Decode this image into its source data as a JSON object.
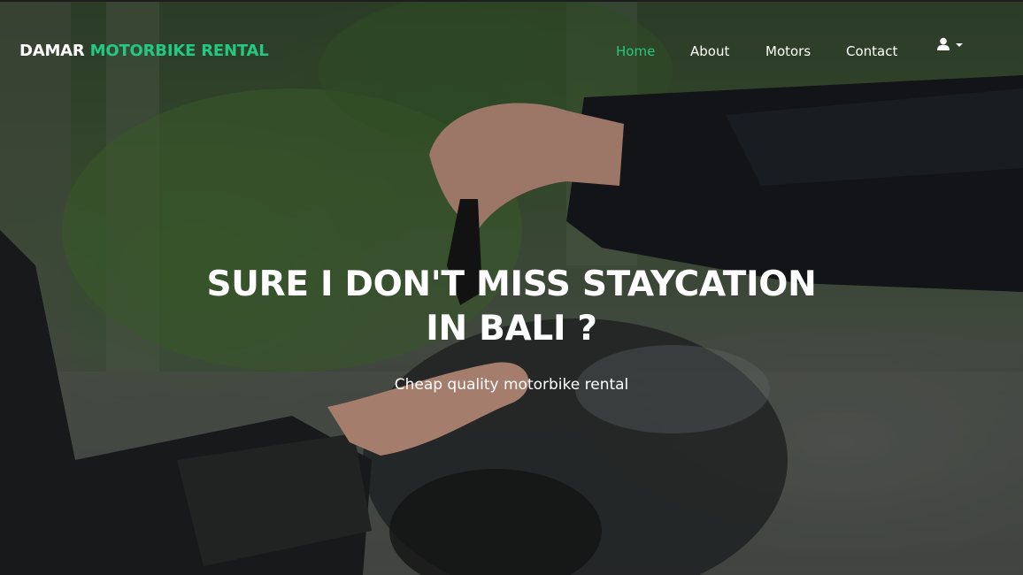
{
  "brand": {
    "primary": "DAMAR",
    "accent": "MOTORBIKE RENTAL"
  },
  "nav": {
    "items": [
      {
        "label": "Home",
        "active": true
      },
      {
        "label": "About",
        "active": false
      },
      {
        "label": "Motors",
        "active": false
      },
      {
        "label": "Contact",
        "active": false
      }
    ],
    "user_icon": "user-icon",
    "dropdown_icon": "caret-down-icon"
  },
  "hero": {
    "title_line1": "SURE I DON'T MISS STAYCATION",
    "title_line2": "IN BALI ?",
    "subtitle": "Cheap quality motorbike rental"
  },
  "colors": {
    "accent": "#22c980",
    "text": "#ffffff"
  }
}
